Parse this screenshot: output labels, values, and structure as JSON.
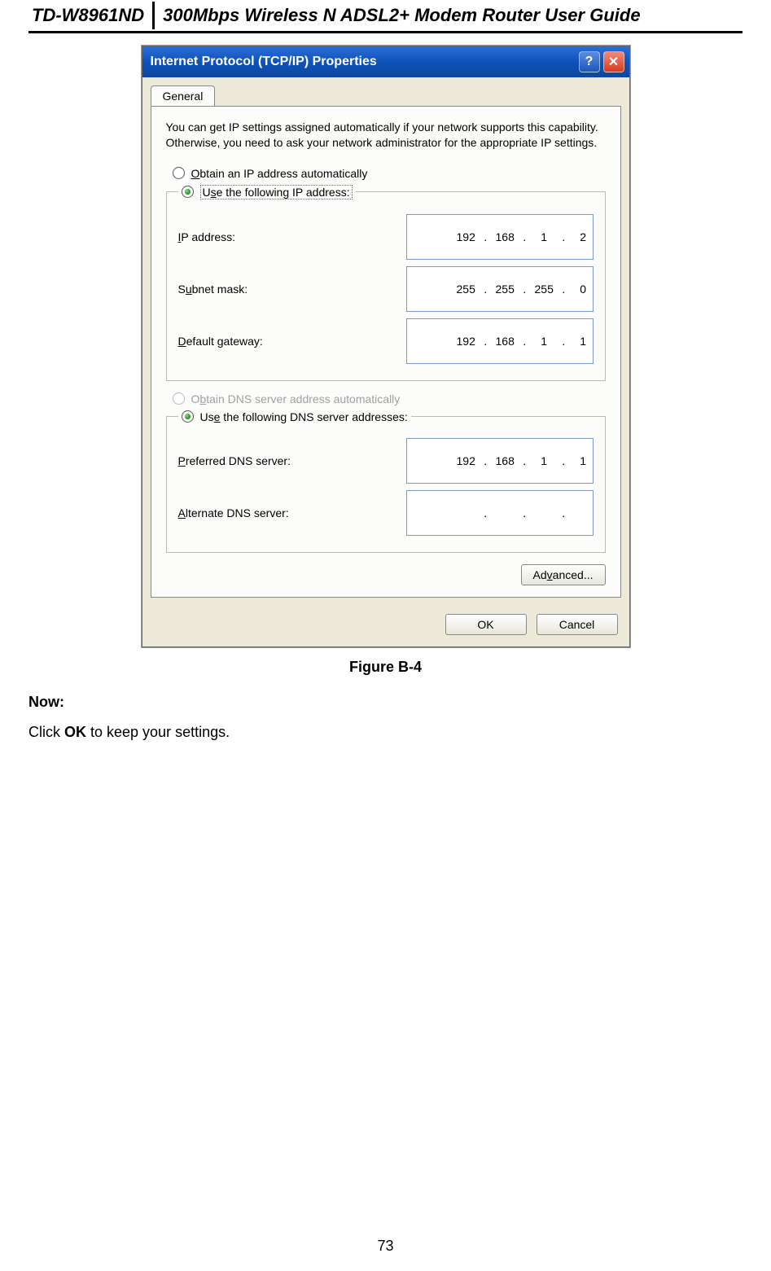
{
  "header": {
    "model": "TD-W8961ND",
    "title": "300Mbps Wireless N ADSL2+ Modem Router User Guide"
  },
  "dialog": {
    "title": "Internet Protocol (TCP/IP) Properties",
    "help_glyph": "?",
    "close_glyph": "✕",
    "tab_label": "General",
    "intro": "You can get IP settings assigned automatically if your network supports this capability. Otherwise, you need to ask your network administrator for the appropriate IP settings.",
    "ip_group": {
      "radio_auto": "Obtain an IP address automatically",
      "radio_manual": "Use the following IP address:",
      "ip_label": "IP address:",
      "ip_value": [
        "192",
        "168",
        "1",
        "2"
      ],
      "subnet_label": "Subnet mask:",
      "subnet_value": [
        "255",
        "255",
        "255",
        "0"
      ],
      "gateway_label": "Default gateway:",
      "gateway_value": [
        "192",
        "168",
        "1",
        "1"
      ]
    },
    "dns_group": {
      "radio_auto": "Obtain DNS server address automatically",
      "radio_manual": "Use the following DNS server addresses:",
      "pref_label": "Preferred DNS server:",
      "pref_value": [
        "192",
        "168",
        "1",
        "1"
      ],
      "alt_label": "Alternate DNS server:",
      "alt_value": [
        "",
        "",
        "",
        ""
      ]
    },
    "advanced_label": "Advanced...",
    "ok_label": "OK",
    "cancel_label": "Cancel"
  },
  "figure_caption": "Figure B-4",
  "now_label": "Now:",
  "instruction_pre": "Click ",
  "instruction_bold": "OK",
  "instruction_post": " to keep your settings.",
  "page_number": "73"
}
